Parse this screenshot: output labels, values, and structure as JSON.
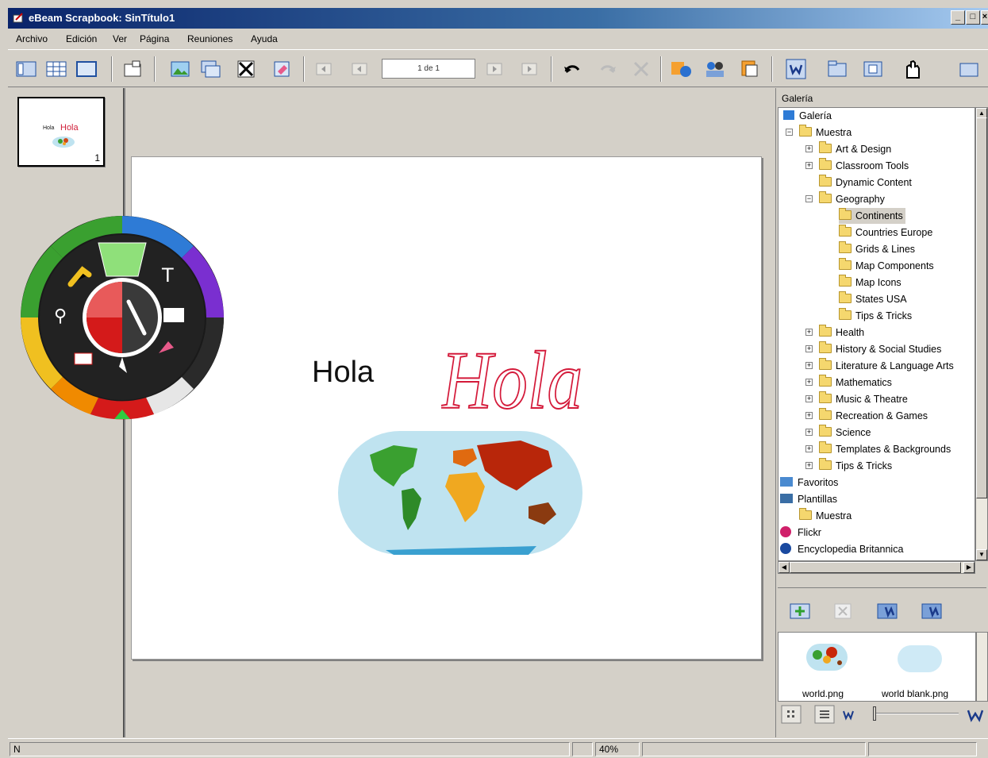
{
  "window": {
    "title": "eBeam Scrapbook: SinTítulo1",
    "controls": [
      "_",
      "□",
      "×"
    ]
  },
  "menu": [
    "Archivo",
    "Edición",
    "Ver",
    "Página",
    "Reuniones",
    "Ayuda"
  ],
  "toolbar": {
    "page_indicator": "1 de 1",
    "icons": [
      "thumbnail-view-icon",
      "grid-view-icon",
      "page-view-icon",
      "window-icon",
      "insert-image-icon",
      "new-page-icon",
      "delete-page-icon",
      "clear-page-icon",
      "first-page-icon",
      "prev-page-icon",
      "next-page-icon",
      "last-page-icon",
      "undo-icon",
      "redo-icon",
      "delete-icon",
      "share-icon",
      "meeting-icon",
      "export-icon",
      "gallery-icon",
      "folder-view-icon",
      "capture-icon",
      "hand-icon",
      "projector-icon"
    ]
  },
  "thumbnail": {
    "number": "1",
    "mini_text": "Hola"
  },
  "canvas": {
    "typed_text": "Hola",
    "handwritten_text": "Hola"
  },
  "gallery": {
    "header": "Galería",
    "tree": [
      {
        "label": "Galería",
        "level": 0,
        "icon": "gallery-icon"
      },
      {
        "label": "Muestra",
        "level": 1,
        "expander": "−"
      },
      {
        "label": "Art & Design",
        "level": 2,
        "expander": "+"
      },
      {
        "label": "Classroom Tools",
        "level": 2,
        "expander": "+"
      },
      {
        "label": "Dynamic Content",
        "level": 2
      },
      {
        "label": "Geography",
        "level": 2,
        "expander": "−"
      },
      {
        "label": "Continents",
        "level": 3,
        "selected": true
      },
      {
        "label": "Countries Europe",
        "level": 3
      },
      {
        "label": "Grids & Lines",
        "level": 3
      },
      {
        "label": "Map Components",
        "level": 3
      },
      {
        "label": "Map Icons",
        "level": 3
      },
      {
        "label": "States USA",
        "level": 3
      },
      {
        "label": "Tips & Tricks",
        "level": 3
      },
      {
        "label": "Health",
        "level": 2,
        "expander": "+"
      },
      {
        "label": "History & Social Studies",
        "level": 2,
        "expander": "+"
      },
      {
        "label": "Literature & Language Arts",
        "level": 2,
        "expander": "+"
      },
      {
        "label": "Mathematics",
        "level": 2,
        "expander": "+"
      },
      {
        "label": "Music & Theatre",
        "level": 2,
        "expander": "+"
      },
      {
        "label": "Recreation & Games",
        "level": 2,
        "expander": "+"
      },
      {
        "label": "Science",
        "level": 2,
        "expander": "+"
      },
      {
        "label": "Templates & Backgrounds",
        "level": 2,
        "expander": "+"
      },
      {
        "label": "Tips & Tricks",
        "level": 2,
        "expander": "+"
      },
      {
        "label": "Favoritos",
        "level": 0,
        "icon": "favorites-icon"
      },
      {
        "label": "Plantillas",
        "level": 0,
        "icon": "templates-icon"
      },
      {
        "label": "Muestra",
        "level": 1
      },
      {
        "label": "Flickr",
        "level": 0,
        "icon": "flickr-icon"
      },
      {
        "label": "Encyclopedia Britannica",
        "level": 0,
        "icon": "britannica-icon"
      }
    ],
    "items": [
      {
        "caption": "world.png"
      },
      {
        "caption": "world blank.png"
      }
    ]
  },
  "status": {
    "left": "N",
    "zoom": "40%"
  },
  "colors": {
    "title_start": "#0a246a",
    "title_end": "#a6caf0",
    "palette_ring": [
      "#2e7bd6",
      "#7a2fd0",
      "#2a2a2a",
      "#e6e6e6",
      "#d41a1a",
      "#f08a00",
      "#f0c020",
      "#3aa030"
    ]
  }
}
